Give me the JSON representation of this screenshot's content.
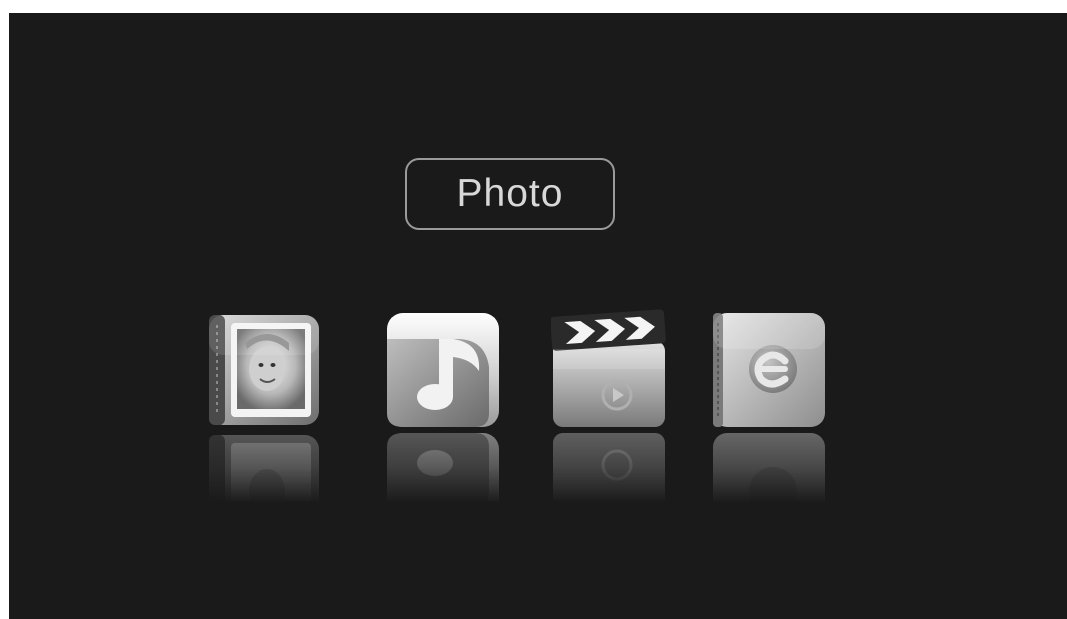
{
  "menu": {
    "selected_label": "Photo"
  },
  "icons": [
    {
      "name": "photo-icon"
    },
    {
      "name": "music-icon"
    },
    {
      "name": "movie-icon"
    },
    {
      "name": "ebook-icon"
    }
  ],
  "colors": {
    "screen_background": "#1a1a1a",
    "title_border": "#9a9a9a",
    "title_text": "#d8d8d8"
  }
}
